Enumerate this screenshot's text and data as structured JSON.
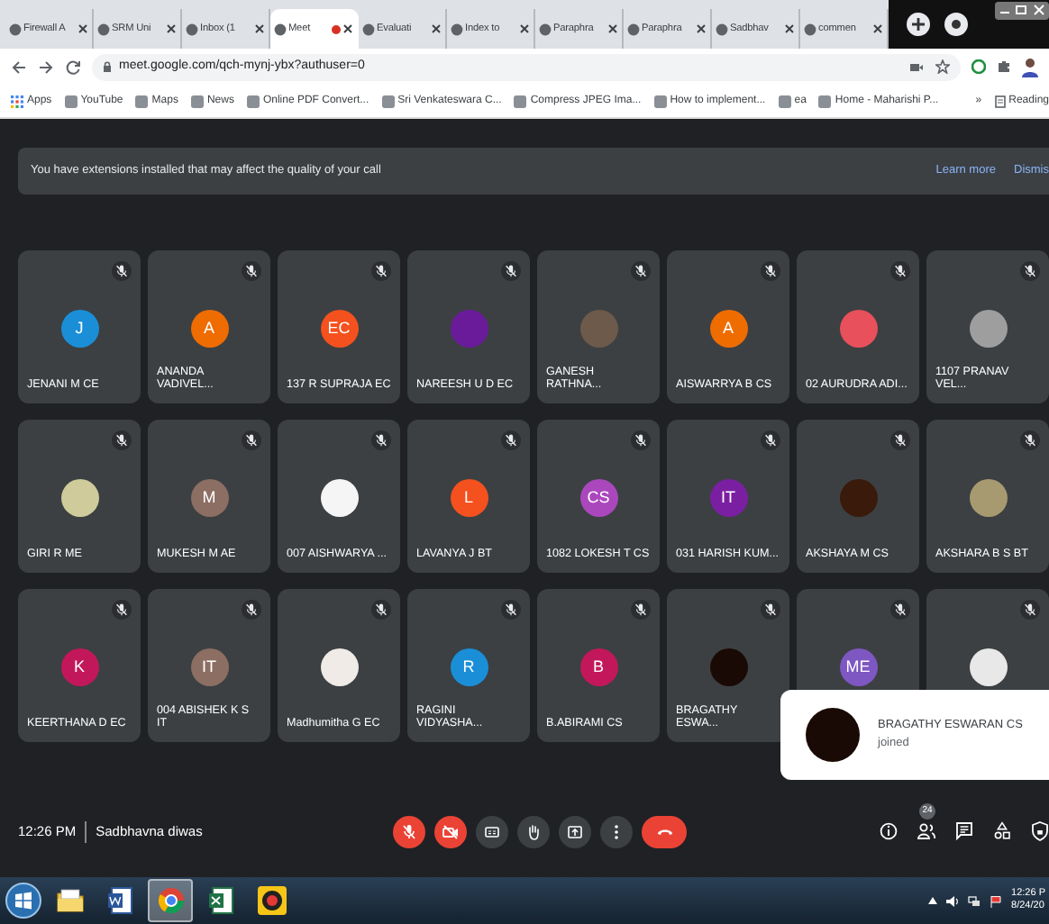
{
  "browser": {
    "tabs": [
      {
        "label": "Firewall A",
        "selected": false,
        "recording": false
      },
      {
        "label": "SRM Uni",
        "selected": false,
        "recording": false
      },
      {
        "label": "Inbox (1",
        "selected": false,
        "recording": false
      },
      {
        "label": "Meet",
        "selected": true,
        "recording": true
      },
      {
        "label": "Evaluati",
        "selected": false,
        "recording": false
      },
      {
        "label": "Index to",
        "selected": false,
        "recording": false
      },
      {
        "label": "Paraphra",
        "selected": false,
        "recording": false
      },
      {
        "label": "Paraphra",
        "selected": false,
        "recording": false
      },
      {
        "label": "Sadbhav",
        "selected": false,
        "recording": false
      },
      {
        "label": "commen",
        "selected": false,
        "recording": false
      }
    ],
    "url": "meet.google.com/qch-mynj-ybx?authuser=0",
    "bookmarks": [
      {
        "kind": "apps",
        "label": "Apps"
      },
      {
        "kind": "site",
        "label": "YouTube"
      },
      {
        "kind": "site",
        "label": "Maps"
      },
      {
        "kind": "site",
        "label": "News"
      },
      {
        "kind": "site",
        "label": "Online PDF Convert..."
      },
      {
        "kind": "site",
        "label": "Sri Venkateswara C..."
      },
      {
        "kind": "site",
        "label": "Compress JPEG Ima..."
      },
      {
        "kind": "site",
        "label": "How to implement..."
      },
      {
        "kind": "site",
        "label": "ea"
      },
      {
        "kind": "site",
        "label": "Home - Maharishi P..."
      }
    ],
    "bookmarks_more": "»",
    "reading_list": "Reading"
  },
  "banner": {
    "message": "You have extensions installed that may affect the quality of your call",
    "links": [
      "Learn more",
      "Dismis"
    ]
  },
  "participants": [
    {
      "name": "JENANI M CE",
      "kind": "letter",
      "initials": "J",
      "color": "#1a8fd8",
      "muted": true
    },
    {
      "name": "ANANDA VADIVEL...",
      "kind": "letter",
      "initials": "A",
      "color": "#ef6c00",
      "muted": true
    },
    {
      "name": "137 R SUPRAJA EC",
      "kind": "letter",
      "initials": "EC",
      "color": "#f4511e",
      "muted": true
    },
    {
      "name": "NAREESH U D EC",
      "kind": "photo",
      "color": "#6a1b9a",
      "muted": true
    },
    {
      "name": "GANESH RATHNA...",
      "kind": "photo",
      "color": "#6d5a4a",
      "muted": true
    },
    {
      "name": "AISWARRYA B CS",
      "kind": "letter",
      "initials": "A",
      "color": "#ef6c00",
      "muted": true
    },
    {
      "name": "02 AURUDRA ADI...",
      "kind": "photo",
      "color": "#e8505b",
      "muted": true
    },
    {
      "name": "1107 PRANAV VEL...",
      "kind": "photo",
      "color": "#9e9e9e",
      "muted": true
    },
    {
      "name": "GIRI R ME",
      "kind": "photo",
      "color": "#cfcb9a",
      "muted": true
    },
    {
      "name": "MUKESH M AE",
      "kind": "letter",
      "initials": "M",
      "color": "#8d6e63",
      "muted": true
    },
    {
      "name": "007 AISHWARYA ...",
      "kind": "photo",
      "color": "#f5f5f5",
      "muted": true
    },
    {
      "name": "LAVANYA J BT",
      "kind": "letter",
      "initials": "L",
      "color": "#f4511e",
      "muted": true
    },
    {
      "name": "1082 LOKESH T CS",
      "kind": "letter",
      "initials": "CS",
      "color": "#ab47bc",
      "muted": true
    },
    {
      "name": "031 HARISH KUM...",
      "kind": "letter",
      "initials": "IT",
      "color": "#7b1fa2",
      "muted": true
    },
    {
      "name": "AKSHAYA M CS",
      "kind": "photo",
      "color": "#3a1a0a",
      "muted": true
    },
    {
      "name": "AKSHARA B S BT",
      "kind": "photo",
      "color": "#a89a70",
      "muted": true
    },
    {
      "name": "KEERTHANA D EC",
      "kind": "letter",
      "initials": "K",
      "color": "#c2185b",
      "muted": true
    },
    {
      "name": "004 ABISHEK K S IT",
      "kind": "letter",
      "initials": "IT",
      "color": "#8d6e63",
      "muted": true
    },
    {
      "name": "Madhumitha G EC",
      "kind": "photo",
      "color": "#f0ebe6",
      "muted": true
    },
    {
      "name": "RAGINI VIDYASHA...",
      "kind": "letter",
      "initials": "R",
      "color": "#1a8fd8",
      "muted": true
    },
    {
      "name": "B.ABIRAMI CS",
      "kind": "letter",
      "initials": "B",
      "color": "#c2185b",
      "muted": true
    },
    {
      "name": "BRAGATHY ESWA...",
      "kind": "photo",
      "color": "#1a0a05",
      "muted": true
    },
    {
      "kind": "letter",
      "initials": "ME",
      "color": "#7e57c2",
      "muted": true
    },
    {
      "kind": "photo",
      "color": "#e8e8e8",
      "muted": true
    }
  ],
  "toast": {
    "name": "BRAGATHY ESWARAN CS",
    "message": "joined",
    "color": "#1a0a05"
  },
  "call_bar": {
    "time": "12:26 PM",
    "meeting_title": "Sadbhavna diwas",
    "controls": [
      {
        "kind": "mic",
        "on": false
      },
      {
        "kind": "camera",
        "on": false
      },
      {
        "kind": "captions"
      },
      {
        "kind": "hand"
      },
      {
        "kind": "present"
      },
      {
        "kind": "more"
      },
      {
        "kind": "end"
      }
    ],
    "side": [
      {
        "kind": "info"
      },
      {
        "kind": "people",
        "badge": "24"
      },
      {
        "kind": "chat"
      },
      {
        "kind": "activities"
      },
      {
        "kind": "host"
      }
    ]
  },
  "taskbar": {
    "apps": [
      {
        "kind": "folder",
        "active": false
      },
      {
        "kind": "word",
        "active": false
      },
      {
        "kind": "chrome",
        "active": true
      },
      {
        "kind": "excel",
        "active": false
      },
      {
        "kind": "recorder",
        "active": false
      }
    ],
    "clock_time": "12:26 P",
    "clock_date": "8/24/20"
  }
}
